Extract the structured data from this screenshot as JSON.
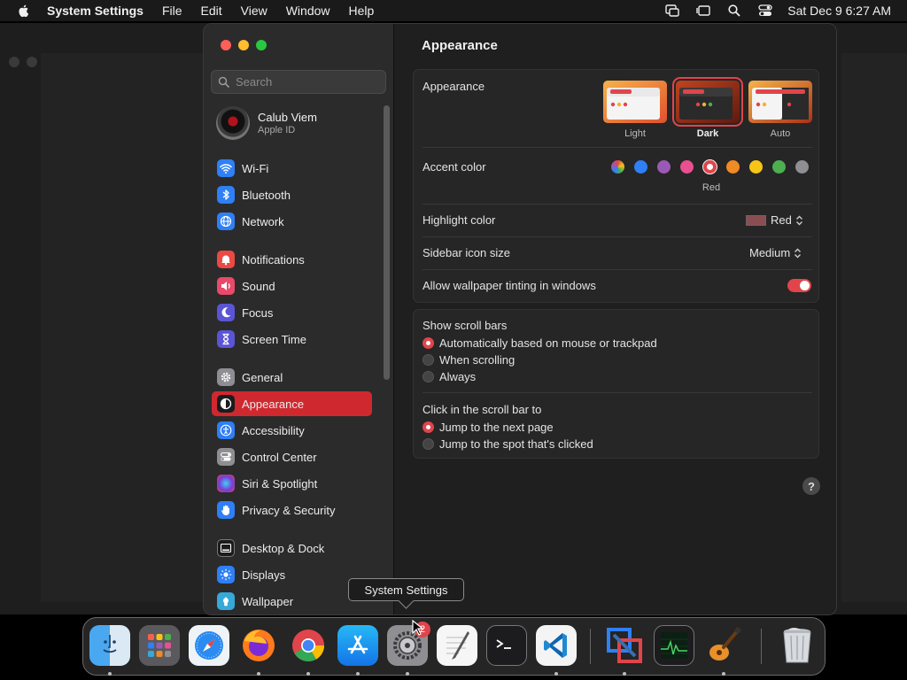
{
  "menubar": {
    "app_name": "System Settings",
    "items": [
      "File",
      "Edit",
      "View",
      "Window",
      "Help"
    ],
    "clock": "Sat Dec 9  6:27 AM"
  },
  "sidebar": {
    "search_placeholder": "Search",
    "profile": {
      "name": "Calub Viem",
      "subtitle": "Apple ID"
    },
    "items": [
      {
        "label": "Wi-Fi",
        "icon": "wifi-icon",
        "color": "#2f7ff5"
      },
      {
        "label": "Bluetooth",
        "icon": "bluetooth-icon",
        "color": "#2f7ff5"
      },
      {
        "label": "Network",
        "icon": "globe-icon",
        "color": "#2f7ff5"
      },
      {
        "label": "Notifications",
        "icon": "bell-icon",
        "color": "#ea4a43"
      },
      {
        "label": "Sound",
        "icon": "speaker-icon",
        "color": "#ea4a6a"
      },
      {
        "label": "Focus",
        "icon": "moon-icon",
        "color": "#5b55d6"
      },
      {
        "label": "Screen Time",
        "icon": "hourglass-icon",
        "color": "#5b55d6"
      },
      {
        "label": "General",
        "icon": "gear-icon",
        "color": "#8e8e93"
      },
      {
        "label": "Appearance",
        "icon": "appearance-icon",
        "color": "#1c1c1e"
      },
      {
        "label": "Accessibility",
        "icon": "accessibility-icon",
        "color": "#2f7ff5"
      },
      {
        "label": "Control Center",
        "icon": "toggles-icon",
        "color": "#8e8e93"
      },
      {
        "label": "Siri & Spotlight",
        "icon": "siri-icon",
        "color": "#7a3bd8"
      },
      {
        "label": "Privacy & Security",
        "icon": "hand-icon",
        "color": "#2f7ff5"
      },
      {
        "label": "Desktop & Dock",
        "icon": "dock-icon",
        "color": "#1c1c1e"
      },
      {
        "label": "Displays",
        "icon": "sun-icon",
        "color": "#2f7ff5"
      },
      {
        "label": "Wallpaper",
        "icon": "wallpaper-icon",
        "color": "#36a9d9"
      }
    ],
    "selected": "Appearance"
  },
  "main": {
    "title": "Appearance",
    "appearance": {
      "label": "Appearance",
      "options": [
        "Light",
        "Dark",
        "Auto"
      ],
      "selected": "Dark"
    },
    "accent": {
      "label": "Accent color",
      "colors": [
        "multicolor",
        "#2f7ff5",
        "#9b59b6",
        "#e8508f",
        "#e0454b",
        "#f08a24",
        "#f5c518",
        "#4caf50",
        "#8e8e93"
      ],
      "selected_index": 4,
      "selected_name": "Red"
    },
    "highlight": {
      "label": "Highlight color",
      "value": "Red",
      "swatch": "#8a4e52"
    },
    "icon_size": {
      "label": "Sidebar icon size",
      "value": "Medium"
    },
    "tinting": {
      "label": "Allow wallpaper tinting in windows",
      "on": true
    },
    "scroll_bars": {
      "label": "Show scroll bars",
      "options": [
        "Automatically based on mouse or trackpad",
        "When scrolling",
        "Always"
      ],
      "selected_index": 0
    },
    "click_scroll": {
      "label": "Click in the scroll bar to",
      "options": [
        "Jump to the next page",
        "Jump to the spot that's clicked"
      ],
      "selected_index": 0
    },
    "help": "?"
  },
  "tooltip": "System Settings",
  "dock": {
    "badge": "2",
    "apps": [
      "Finder",
      "Launchpad",
      "Safari",
      "Firefox",
      "Chrome",
      "App Store",
      "System Settings",
      "TextEdit",
      "Terminal",
      "VS Code",
      "VMware",
      "Activity Monitor",
      "GarageBand",
      "Trash"
    ]
  }
}
